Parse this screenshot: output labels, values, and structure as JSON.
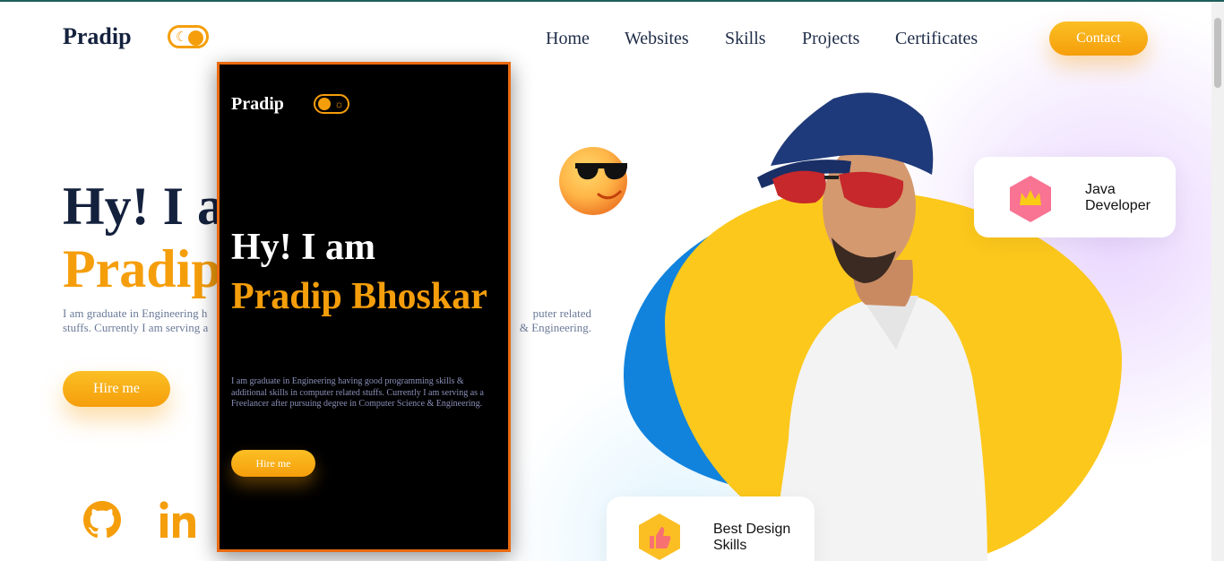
{
  "header": {
    "logo": "Pradip",
    "nav": [
      "Home",
      "Websites",
      "Skills",
      "Projects",
      "Certificates"
    ],
    "contact_label": "Contact"
  },
  "hero": {
    "greeting_partial": "Hy! I a",
    "name_partial": "Pradip",
    "description_line1": "I am graduate in Engineering h",
    "description_line2": "stuffs. Currently I am serving a",
    "description_line1_tail": "puter related",
    "description_line2_tail": "& Engineering.",
    "hire_label": "Hire me"
  },
  "cards": {
    "java": "Java Developer",
    "design": "Best Design Skills"
  },
  "phone_preview": {
    "logo": "Pradip",
    "greeting": "Hy! I am",
    "name": "Pradip Bhoskar",
    "description": "I am graduate in Engineering having good programming skills & additional skills in computer related stuffs. Currently I am serving as a Freelancer after pursuing degree in Computer Science & Engineering.",
    "hire_label": "Hire me"
  },
  "icons": {
    "theme_toggle": "moon-icon",
    "social": [
      "github-icon",
      "linkedin-icon"
    ],
    "emoji": "sunglasses-emoji-icon",
    "java_card": "crown-icon",
    "design_card": "thumbs-up-icon"
  },
  "colors": {
    "accent": "#f59e0b",
    "dark": "#14213d",
    "blob_yellow": "#fcc81c",
    "blob_blue": "#1183dd",
    "phone_border": "#ea6a10"
  }
}
